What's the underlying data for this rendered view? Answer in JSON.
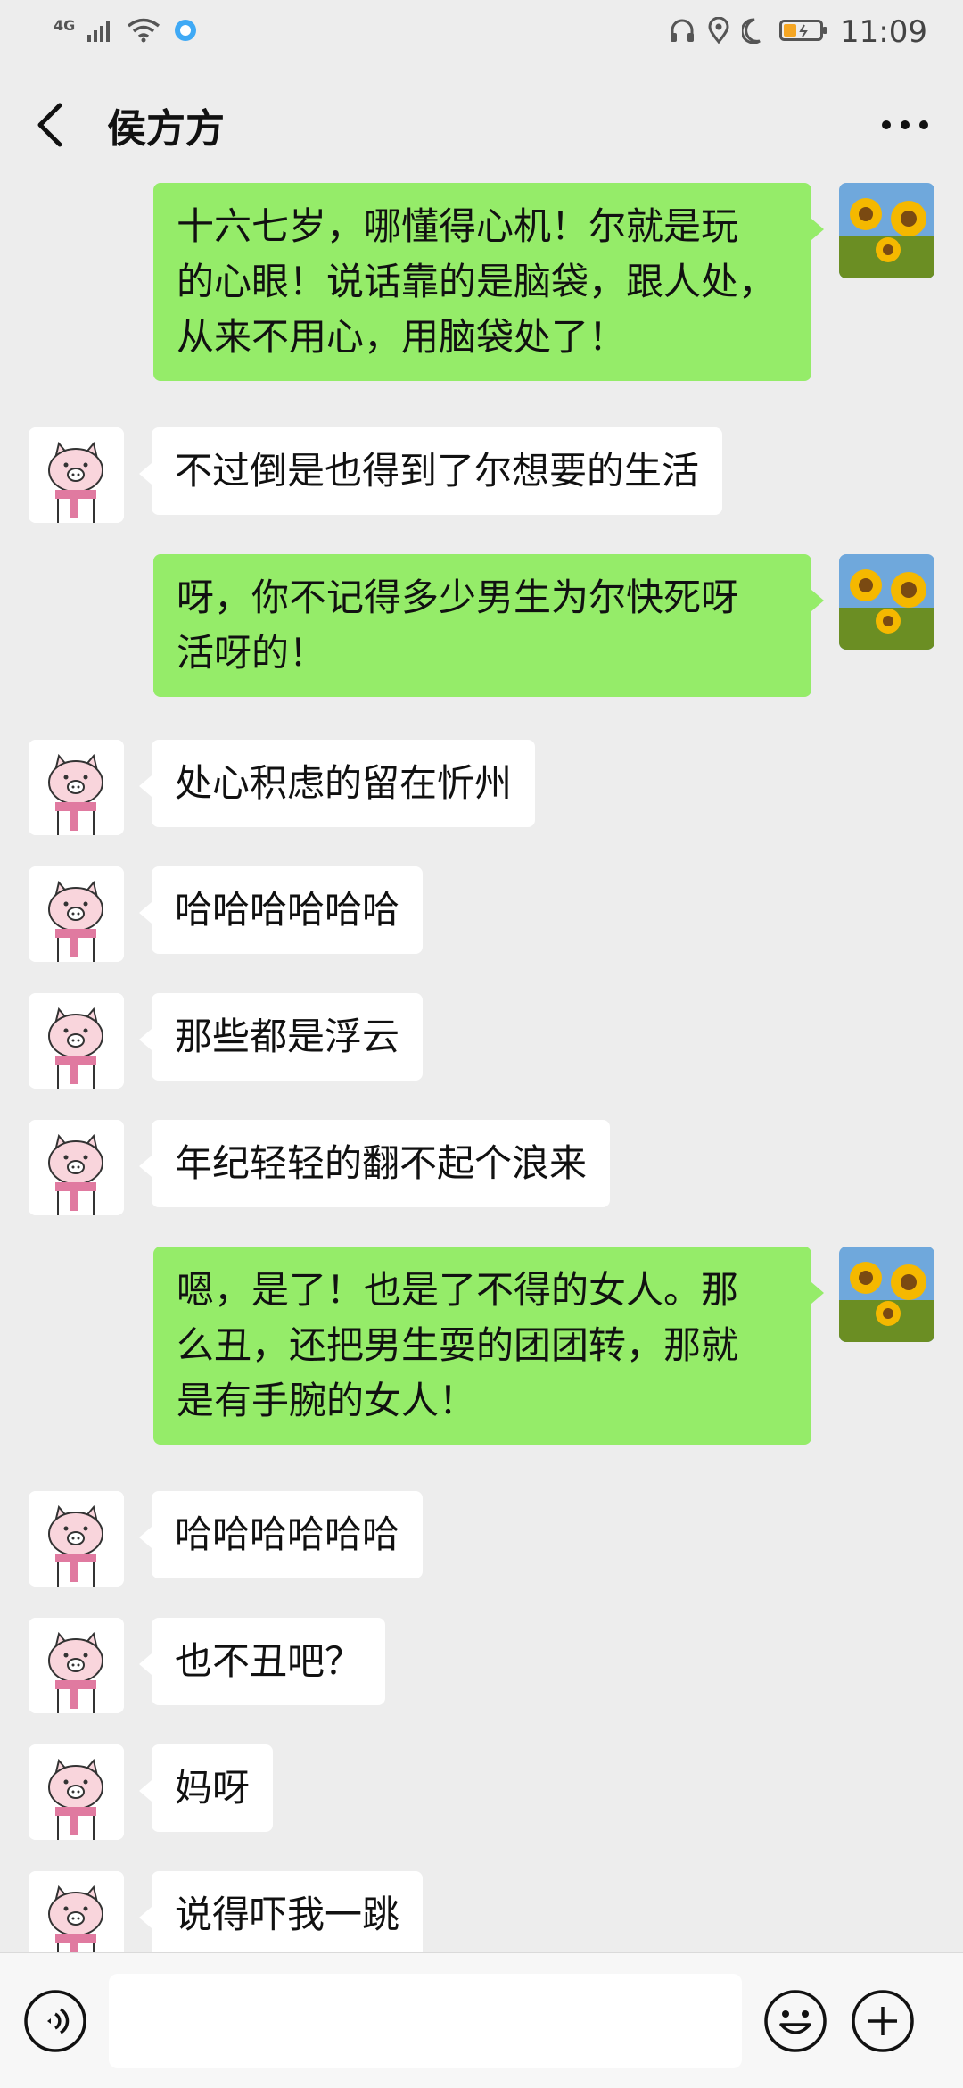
{
  "status_bar": {
    "network": "4G",
    "time": "11:09"
  },
  "header": {
    "title": "侯方方"
  },
  "messages": [
    {
      "side": "right",
      "text": "十六七岁，哪懂得心机！尔就是玩\n的心眼！说话靠的是脑袋，跟人处，\n从来不用心，用脑袋处了！"
    },
    {
      "side": "left",
      "text": "不过倒是也得到了尔想要的生活"
    },
    {
      "side": "right",
      "text": "呀，你不记得多少男生为尔快死呀\n活呀的！"
    },
    {
      "side": "left",
      "text": "处心积虑的留在忻州"
    },
    {
      "side": "left",
      "text": "哈哈哈哈哈哈"
    },
    {
      "side": "left",
      "text": "那些都是浮云"
    },
    {
      "side": "left",
      "text": "年纪轻轻的翻不起个浪来"
    },
    {
      "side": "right",
      "text": "嗯，是了！也是了不得的女人。那\n么丑，还把男生耍的团团转，那就\n是有手腕的女人！"
    },
    {
      "side": "left",
      "text": "哈哈哈哈哈哈"
    },
    {
      "side": "left",
      "text": "也不丑吧？"
    },
    {
      "side": "left",
      "text": "妈呀"
    },
    {
      "side": "left",
      "text": "说得吓我一跳"
    }
  ],
  "input_bar": {
    "value": "",
    "icons": [
      "voice-icon",
      "emoji-icon",
      "plus-icon"
    ]
  },
  "colors": {
    "background": "#EDEDED",
    "bubble_self": "#95EC69",
    "bubble_other": "#FFFFFF"
  }
}
